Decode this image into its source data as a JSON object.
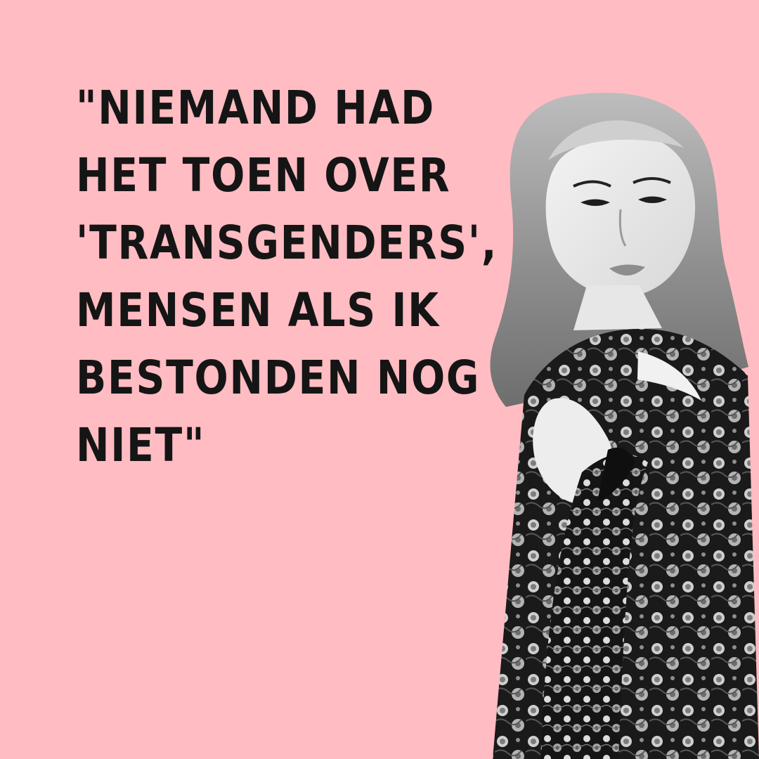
{
  "quote": {
    "lines": [
      "\"NIEMAND HAD",
      "HET TOEN OVER",
      "'TRANSGENDERS',",
      "MENSEN ALS IK",
      "BESTONDEN NOG",
      "NIET\""
    ]
  },
  "colors": {
    "background": "#ffbcc2",
    "text": "#151515"
  },
  "image": {
    "subject": "person-portrait-black-and-white"
  }
}
